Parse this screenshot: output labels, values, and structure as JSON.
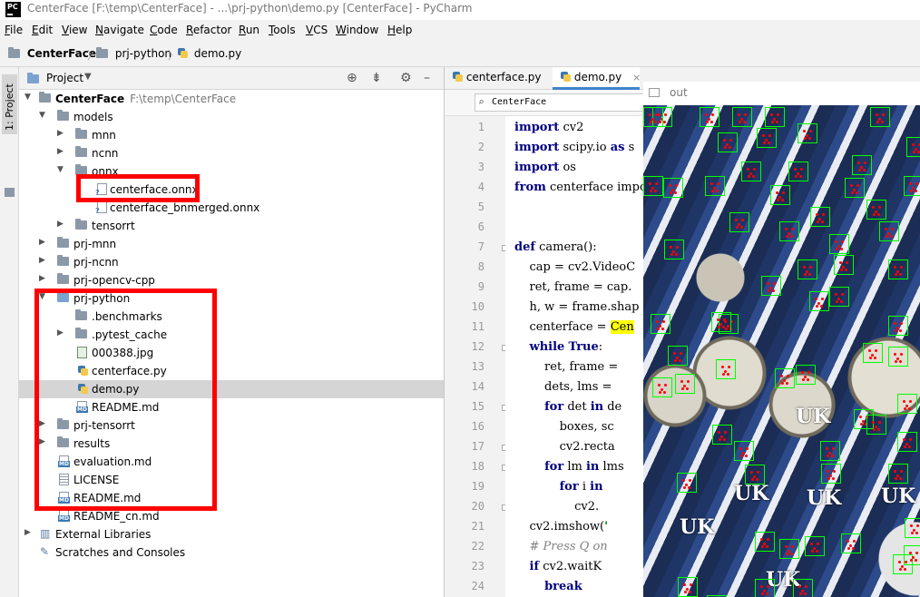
{
  "window": {
    "title": "CenterFace [F:\\temp\\CenterFace] - ...\\prj-python\\demo.py [CenterFace] - PyCharm",
    "app_icon": "PC"
  },
  "menu": [
    "File",
    "Edit",
    "View",
    "Navigate",
    "Code",
    "Refactor",
    "Run",
    "Tools",
    "VCS",
    "Window",
    "Help"
  ],
  "breadcrumb": [
    "CenterFace",
    "prj-python",
    "demo.py"
  ],
  "sidebar_tabs": {
    "project": "1: Project"
  },
  "project_panel": {
    "title": "Project"
  },
  "tree": [
    {
      "label": "CenterFace",
      "path": "F:\\temp\\CenterFace",
      "icon": "folder-icon",
      "expanded": true
    },
    {
      "label": "models",
      "icon": "folder-icon",
      "expanded": true
    },
    {
      "label": "mnn",
      "icon": "folder-icon",
      "expanded": false
    },
    {
      "label": "ncnn",
      "icon": "folder-icon",
      "expanded": false
    },
    {
      "label": "onnx",
      "icon": "folder-icon",
      "expanded": true
    },
    {
      "label": "centerface.onnx",
      "icon": "unknown-file-icon"
    },
    {
      "label": "centerface_bnmerged.onnx",
      "icon": "unknown-file-icon"
    },
    {
      "label": "tensorrt",
      "icon": "folder-icon",
      "expanded": false
    },
    {
      "label": "prj-mnn",
      "icon": "folder-icon",
      "expanded": false
    },
    {
      "label": "prj-ncnn",
      "icon": "folder-icon",
      "expanded": false
    },
    {
      "label": "prj-opencv-cpp",
      "icon": "folder-icon",
      "expanded": false
    },
    {
      "label": "prj-python",
      "icon": "folder-icon",
      "expanded": true
    },
    {
      "label": ".benchmarks",
      "icon": "folder-icon"
    },
    {
      "label": ".pytest_cache",
      "icon": "folder-icon",
      "expanded": false
    },
    {
      "label": "000388.jpg",
      "icon": "image-file-icon"
    },
    {
      "label": "centerface.py",
      "icon": "python-file-icon"
    },
    {
      "label": "demo.py",
      "icon": "python-file-icon",
      "selected": true
    },
    {
      "label": "README.md",
      "icon": "markdown-file-icon"
    },
    {
      "label": "prj-tensorrt",
      "icon": "folder-icon",
      "expanded": false
    },
    {
      "label": "results",
      "icon": "folder-icon",
      "expanded": false
    },
    {
      "label": "evaluation.md",
      "icon": "markdown-file-icon"
    },
    {
      "label": "LICENSE",
      "icon": "text-file-icon"
    },
    {
      "label": "README.md",
      "icon": "markdown-file-icon"
    },
    {
      "label": "README_cn.md",
      "icon": "markdown-file-icon"
    },
    {
      "label": "External Libraries",
      "icon": "libraries-icon",
      "expanded": false
    },
    {
      "label": "Scratches and Consoles",
      "icon": "scratches-icon"
    }
  ],
  "editor": {
    "tabs": [
      {
        "label": "centerface.py",
        "active": false
      },
      {
        "label": "demo.py",
        "active": true
      }
    ],
    "structure_search": "CenterFace",
    "line_numbers": [
      "1",
      "2",
      "3",
      "4",
      "5",
      "6",
      "7",
      "8",
      "9",
      "10",
      "11",
      "12",
      "13",
      "14",
      "15",
      "16",
      "17",
      "18",
      "19",
      "20",
      "21",
      "22",
      "23",
      "24"
    ],
    "code_lines": [
      "import cv2",
      "import scipy.io as s",
      "import os",
      "from centerface impo",
      "",
      "",
      "def camera():",
      "    cap = cv2.VideoC",
      "    ret, frame = cap.",
      "    h, w = frame.shap",
      "    centerface = Cen",
      "    while True:",
      "        ret, frame =",
      "        dets, lms =",
      "        for det in de",
      "            boxes, sc",
      "            cv2.recta",
      "        for lm in lms",
      "            for i in",
      "                cv2.",
      "    cv2.imshow('",
      "    # Press Q on",
      "    if cv2.waitK",
      "        break"
    ]
  },
  "output_window": {
    "title": "out"
  }
}
